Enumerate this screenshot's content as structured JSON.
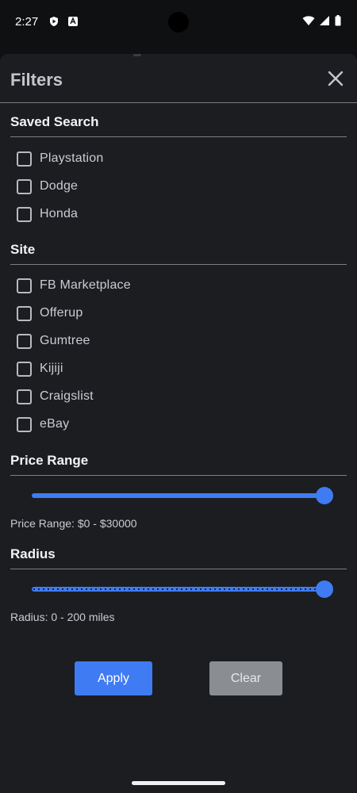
{
  "status": {
    "time": "2:27"
  },
  "sheet": {
    "title": "Filters"
  },
  "saved_search": {
    "title": "Saved Search",
    "items": [
      {
        "label": "Playstation",
        "checked": false
      },
      {
        "label": "Dodge",
        "checked": false
      },
      {
        "label": "Honda",
        "checked": false
      }
    ]
  },
  "site": {
    "title": "Site",
    "items": [
      {
        "label": "FB Marketplace",
        "checked": false
      },
      {
        "label": "Offerup",
        "checked": false
      },
      {
        "label": "Gumtree",
        "checked": false
      },
      {
        "label": "Kijiji",
        "checked": false
      },
      {
        "label": "Craigslist",
        "checked": false
      },
      {
        "label": "eBay",
        "checked": false
      }
    ]
  },
  "price_range": {
    "title": "Price Range",
    "value_text": "Price Range: $0 - $30000",
    "slider_fraction": 1.0
  },
  "radius": {
    "title": "Radius",
    "value_text": "Radius: 0 -  200 miles",
    "slider_fraction": 1.0
  },
  "actions": {
    "apply_label": "Apply",
    "clear_label": "Clear"
  },
  "colors": {
    "accent": "#3f7bf3",
    "sheet_bg": "#1b1d21",
    "clear_bg": "#8a8e93"
  }
}
